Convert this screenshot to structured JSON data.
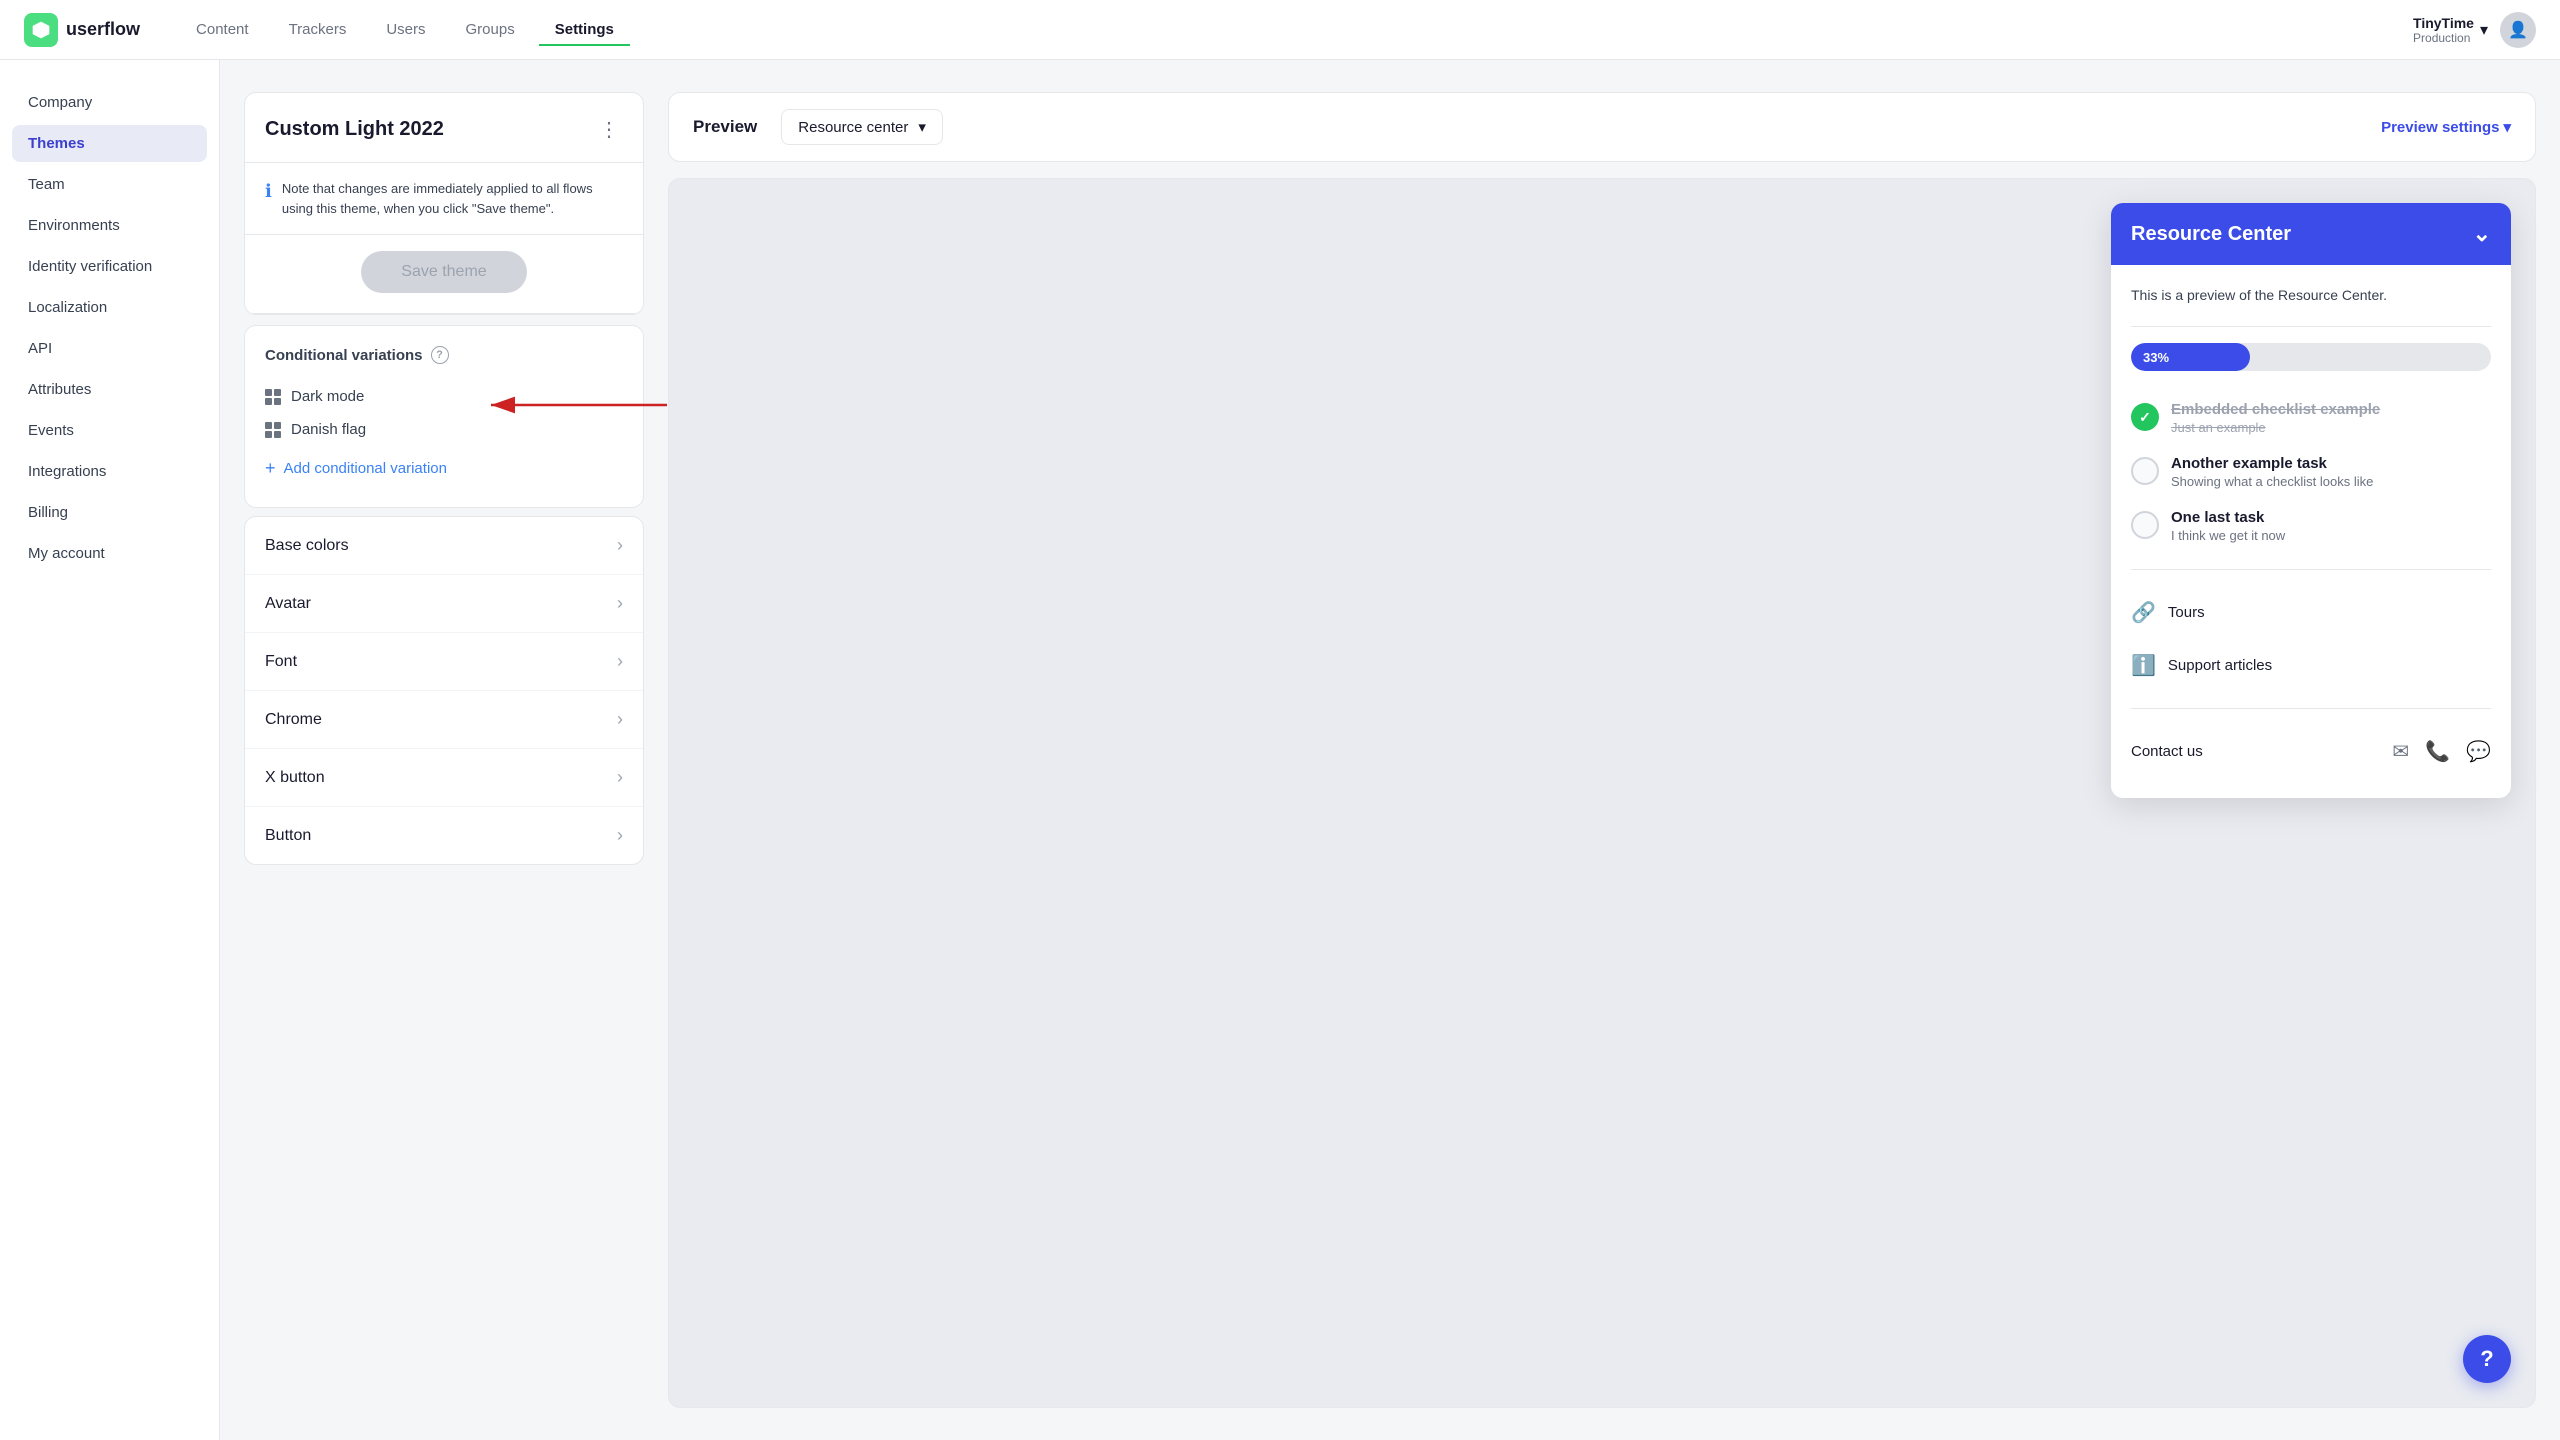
{
  "app": {
    "logo_text": "userflow",
    "nav": [
      {
        "label": "Content",
        "active": false
      },
      {
        "label": "Trackers",
        "active": false
      },
      {
        "label": "Users",
        "active": false
      },
      {
        "label": "Groups",
        "active": false
      },
      {
        "label": "Settings",
        "active": true
      }
    ],
    "org_name": "TinyTime",
    "org_env": "Production",
    "settings_active": "Settings"
  },
  "sidebar": {
    "items": [
      {
        "label": "Company",
        "active": false
      },
      {
        "label": "Themes",
        "active": true
      },
      {
        "label": "Team",
        "active": false
      },
      {
        "label": "Environments",
        "active": false
      },
      {
        "label": "Identity verification",
        "active": false
      },
      {
        "label": "Localization",
        "active": false
      },
      {
        "label": "API",
        "active": false
      },
      {
        "label": "Attributes",
        "active": false
      },
      {
        "label": "Events",
        "active": false
      },
      {
        "label": "Integrations",
        "active": false
      },
      {
        "label": "Billing",
        "active": false
      },
      {
        "label": "My account",
        "active": false
      }
    ]
  },
  "theme_panel": {
    "title": "Custom Light 2022",
    "note": "Note that changes are immediately applied to all flows using this theme, when you click \"Save theme\".",
    "save_label": "Save theme",
    "conditional_variations_title": "Conditional variations",
    "help_icon": "?",
    "variations": [
      {
        "label": "Dark mode"
      },
      {
        "label": "Danish flag"
      }
    ],
    "add_variation_label": "Add conditional variation",
    "settings_rows": [
      {
        "label": "Base colors"
      },
      {
        "label": "Avatar"
      },
      {
        "label": "Font"
      },
      {
        "label": "Chrome"
      },
      {
        "label": "X button"
      },
      {
        "label": "Button"
      }
    ]
  },
  "preview": {
    "label": "Preview",
    "dropdown_label": "Resource center",
    "settings_label": "Preview settings",
    "resource_center": {
      "title": "Resource Center",
      "preview_text": "This is a preview of the Resource Center.",
      "progress_pct": 33,
      "progress_label": "33%",
      "checklist": [
        {
          "title": "Embedded checklist example",
          "subtitle": "Just an example",
          "done": true
        },
        {
          "title": "Another example task",
          "subtitle": "Showing what a checklist looks like",
          "done": false
        },
        {
          "title": "One last task",
          "subtitle": "I think we get it now",
          "done": false
        }
      ],
      "links": [
        {
          "icon": "🔗",
          "label": "Tours"
        },
        {
          "icon": "ℹ️",
          "label": "Support articles"
        }
      ],
      "contact_label": "Contact us",
      "contact_icons": [
        "✉",
        "📞",
        "💬"
      ]
    }
  }
}
